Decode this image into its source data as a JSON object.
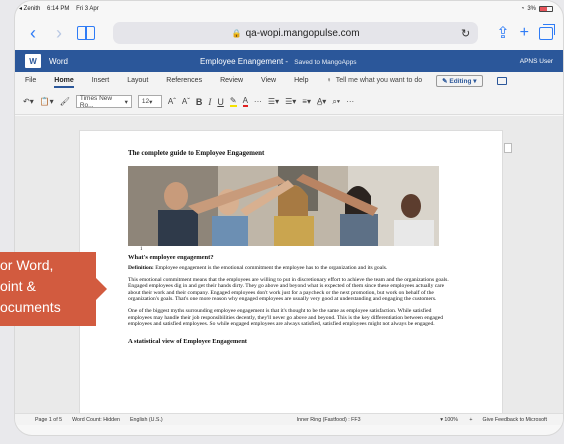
{
  "status_bar": {
    "device": "◂ Zenith",
    "time": "6:14 PM",
    "date": "Fri 3 Apr",
    "battery": "3%"
  },
  "browser": {
    "url": "qa-wopi.mangopulse.com"
  },
  "word_header": {
    "app_name": "Word",
    "doc_title": "Employee Enangement",
    "saved_status": "Saved to MangoApps",
    "user": "APNS User"
  },
  "menu": {
    "tabs": [
      "File",
      "Home",
      "Insert",
      "Layout",
      "References",
      "Review",
      "View",
      "Help"
    ],
    "active_tab": "Home",
    "tell_me": "Tell me what you want to do",
    "editing_label": "Editing"
  },
  "ribbon": {
    "font_name": "Times New Ro...",
    "font_size": "12",
    "grow": "Aˆ",
    "shrink": "Aˇ",
    "bold": "B",
    "italic": "I",
    "underline": "U",
    "highlight": "✎",
    "font_color": "A",
    "more": "···"
  },
  "document": {
    "title": "The complete  guide to Employee Engagement",
    "paragraph_mark": "1",
    "h1": "What's employee engagement?",
    "def_label": "Definition:",
    "def_text": " Employee engagement is the emotional  commitment  the employee has to the organization and its goals.",
    "p1": "This emotional commitment  means that the employees  are willing to put in discretionary effort to  achieve the team and the organizations goals. Engaged employees  dig in and get their hands dirty. They go above and beyond what is expected  of them since these employees  actually care about their work and their company. Engaged employees  don't work just for a paycheck or the next promotion,  but work on behalf of the organization's goals. That's one more reason why engaged employees  are usually very good at understanding and engaging the customers.",
    "p2": "One of the biggest myths  surrounding  employee engagement is that it's thought to be the same as employee satisfaction.  While satisfied employees  may handle their job responsibilities decently, they'll never go above and beyond.  This is the key differentiation  between  engaged employees  and satisfied employees.  So while engaged employees are always satisfied, satisfied employees  might not always be engaged.",
    "h2": "A statistical view of Employee  Engagement"
  },
  "callout": {
    "line1": "or Word,",
    "line2": "oint &",
    "line3": "ocuments"
  },
  "status_line": {
    "page": "Page 1 of 5",
    "word_count": "Word Count: Hidden",
    "language": "English (U.S.)",
    "ring": "Inner Ring (Fastfood) : FF3",
    "zoom": "100%",
    "feedback": "Give Feedback to Microsoft"
  }
}
